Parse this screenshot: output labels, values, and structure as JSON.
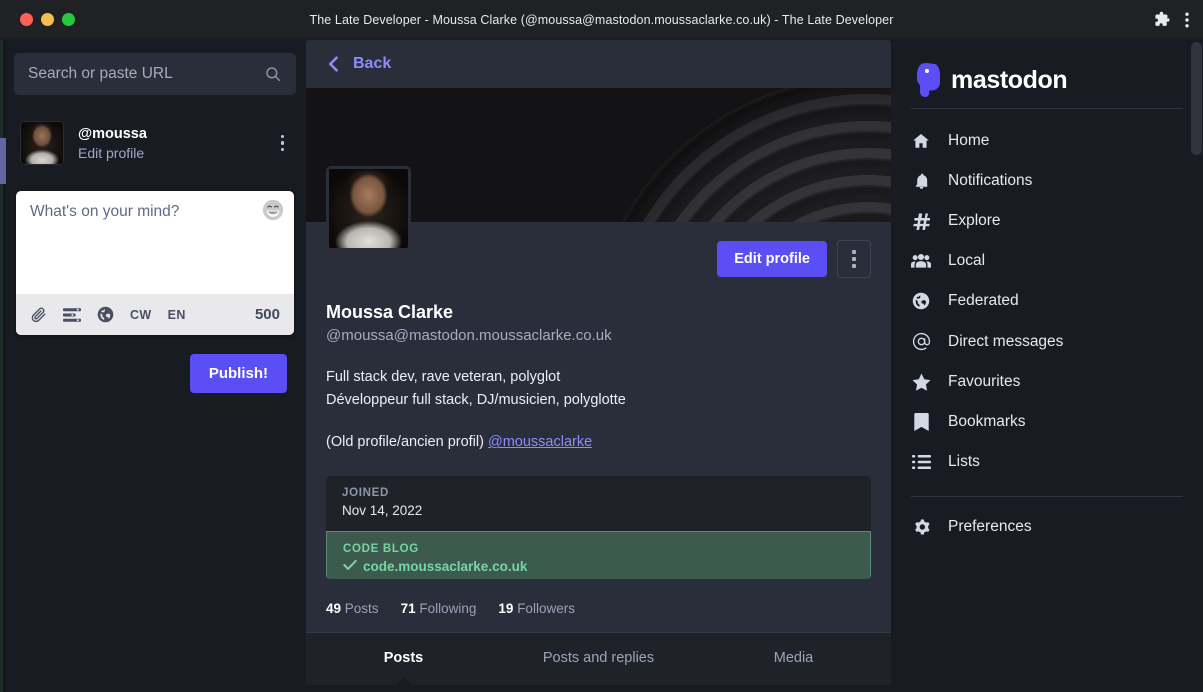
{
  "window": {
    "title": "The Late Developer - Moussa Clarke (@moussa@mastodon.moussaclarke.co.uk) - The Late Developer",
    "controls": {
      "close": "close",
      "minimize": "minimize",
      "maximize": "maximize"
    },
    "toolbar_icons": {
      "extensions": "puzzle-piece-icon",
      "menu": "three-dot-menu-icon"
    }
  },
  "left_panel": {
    "search": {
      "placeholder": "Search or paste URL",
      "icon": "search-icon"
    },
    "account": {
      "handle": "@moussa",
      "edit_link": "Edit profile",
      "avatar": "user-avatar",
      "menu_icon": "vertical-dots-icon"
    },
    "compose": {
      "placeholder": "What's on your mind?",
      "emoji_icon": "grinning-emoji-icon",
      "toolbar": {
        "attach": "paperclip-icon",
        "poll": "poll-icon",
        "visibility": "globe-icon",
        "cw_label": "CW",
        "lang_label": "EN",
        "char_count": "500"
      },
      "publish_label": "Publish!"
    }
  },
  "center_panel": {
    "back_label": "Back",
    "back_icon": "chevron-left-icon",
    "banner_alt": "vinyl-record-banner",
    "profile": {
      "display_name": "Moussa Clarke",
      "handle": "@moussa@mastodon.moussaclarke.co.uk",
      "bio_line1": "Full stack dev, rave veteran, polyglot",
      "bio_line2": "Développeur full stack, DJ/musicien, polyglotte",
      "bio_line3_prefix": "(Old profile/ancien profil) ",
      "bio_link": "@moussaclarke",
      "edit_button": "Edit profile",
      "more_icon": "vertical-dots-icon"
    },
    "fields": [
      {
        "label": "JOINED",
        "value": "Nov 14, 2022",
        "verified": false
      },
      {
        "label": "CODE BLOG",
        "value": "code.moussaclarke.co.uk",
        "verified": true,
        "check_icon": "check-icon"
      }
    ],
    "stats": [
      {
        "count": "49",
        "label": "Posts"
      },
      {
        "count": "71",
        "label": "Following"
      },
      {
        "count": "19",
        "label": "Followers"
      }
    ],
    "tabs": [
      {
        "label": "Posts",
        "active": true
      },
      {
        "label": "Posts and replies",
        "active": false
      },
      {
        "label": "Media",
        "active": false
      }
    ]
  },
  "right_panel": {
    "brand": "mastodon",
    "brand_logo": "mastodon-logo-icon",
    "nav": [
      {
        "label": "Home",
        "icon": "home-icon"
      },
      {
        "label": "Notifications",
        "icon": "bell-icon"
      },
      {
        "label": "Explore",
        "icon": "hashtag-icon"
      },
      {
        "label": "Local",
        "icon": "people-group-icon"
      },
      {
        "label": "Federated",
        "icon": "globe-icon"
      },
      {
        "label": "Direct messages",
        "icon": "at-sign-icon"
      },
      {
        "label": "Favourites",
        "icon": "star-icon"
      },
      {
        "label": "Bookmarks",
        "icon": "bookmark-icon"
      },
      {
        "label": "Lists",
        "icon": "list-icon"
      }
    ],
    "settings": [
      {
        "label": "Preferences",
        "icon": "gear-icon"
      }
    ]
  },
  "colors": {
    "accent": "#5c4ef5",
    "link": "#8c8dfb",
    "verified": "#79d4a4",
    "panel": "#2a2e3a",
    "background": "#191b22"
  }
}
